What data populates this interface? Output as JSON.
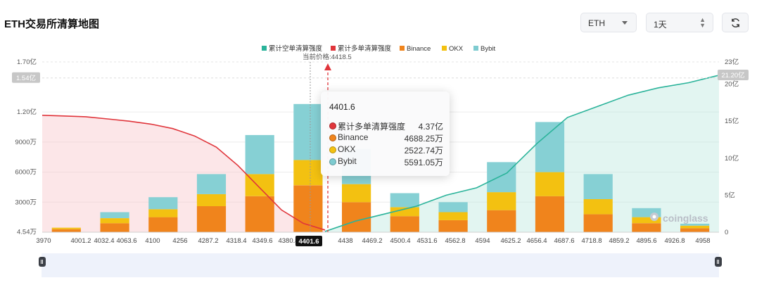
{
  "page": {
    "title": "ETH交易所清算地图"
  },
  "controls": {
    "coin": "ETH",
    "period": "1天"
  },
  "tooltip": {
    "title": "4401.6",
    "rows": [
      {
        "label": "累计多单清算强度",
        "value": "4.37亿",
        "color": "#e0353b"
      },
      {
        "label": "Binance",
        "value": "4688.25万",
        "color": "#f0841c"
      },
      {
        "label": "OKX",
        "value": "2522.74万",
        "color": "#f3c111"
      },
      {
        "label": "Bybit",
        "value": "5591.05万",
        "color": "#7ecbd0"
      }
    ]
  },
  "watermark": "coinglass",
  "chart_data": {
    "type": "bar",
    "current_price_label": "当前价格:4418.5",
    "highlight_x_label": "4401.6",
    "legend": [
      {
        "name": "累计空单清算强度",
        "color": "#2ab39a"
      },
      {
        "name": "累计多单清算强度",
        "color": "#e0353b"
      },
      {
        "name": "Binance",
        "color": "#f0841c"
      },
      {
        "name": "OKX",
        "color": "#f3c111"
      },
      {
        "name": "Bybit",
        "color": "#7ecbd0"
      }
    ],
    "x_ticks": [
      "3970",
      "4001.2",
      "4032.4",
      "4063.6",
      "4100",
      "4256",
      "4287.2",
      "4318.4",
      "4349.6",
      "4380.8",
      "4438",
      "4469.2",
      "4500.4",
      "4531.6",
      "4562.8",
      "4594",
      "4625.2",
      "4656.4",
      "4687.6",
      "4718.8",
      "4859.2",
      "4895.6",
      "4926.8",
      "4958"
    ],
    "y_left": {
      "ticks": [
        "4.54万",
        "3000万",
        "6000万",
        "9000万",
        "1.20亿",
        "1.70亿"
      ],
      "range_wan": [
        0,
        17000
      ],
      "marker": "1.54亿"
    },
    "y_right": {
      "ticks": [
        "0",
        "5亿",
        "10亿",
        "15亿",
        "20亿",
        "23亿"
      ],
      "range_yi": [
        0,
        23
      ],
      "marker": "21.20亿"
    },
    "long_cumulative_yi": [
      15.8,
      15.7,
      15.6,
      15.3,
      15.0,
      14.6,
      14.0,
      13.0,
      11.5,
      9.0,
      6.0,
      3.0,
      1.2,
      0.3
    ],
    "short_cumulative_yi": [
      0.1,
      1.5,
      2.5,
      3.5,
      5.0,
      6.0,
      8.0,
      12.0,
      15.5,
      17.0,
      18.5,
      19.5,
      20.2,
      21.2
    ],
    "bars_wan": [
      {
        "binance": 300,
        "okx": 150,
        "bybit": 0
      },
      {
        "binance": 900,
        "okx": 500,
        "bybit": 600
      },
      {
        "binance": 1500,
        "okx": 800,
        "bybit": 1200
      },
      {
        "binance": 2600,
        "okx": 1200,
        "bybit": 2000
      },
      {
        "binance": 3600,
        "okx": 2200,
        "bybit": 3900
      },
      {
        "binance": 4688.25,
        "okx": 2522.74,
        "bybit": 5591.05
      },
      {
        "binance": 3000,
        "okx": 1800,
        "bybit": 3500
      },
      {
        "binance": 1600,
        "okx": 900,
        "bybit": 1400
      },
      {
        "binance": 1200,
        "okx": 800,
        "bybit": 1000
      },
      {
        "binance": 2200,
        "okx": 1800,
        "bybit": 3000
      },
      {
        "binance": 3600,
        "okx": 2400,
        "bybit": 5000
      },
      {
        "binance": 1800,
        "okx": 1500,
        "bybit": 2500
      },
      {
        "binance": 900,
        "okx": 600,
        "bybit": 900
      },
      {
        "binance": 400,
        "okx": 250,
        "bybit": 200
      }
    ]
  }
}
